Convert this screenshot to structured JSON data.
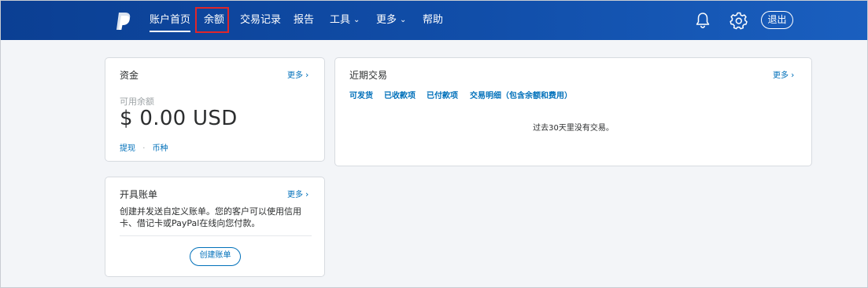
{
  "nav": {
    "items": [
      {
        "label": "账户首页",
        "active": true
      },
      {
        "label": "余额",
        "active": false
      },
      {
        "label": "交易记录",
        "active": false
      },
      {
        "label": "报告",
        "active": false
      },
      {
        "label": "工具",
        "active": false,
        "dropdown": true
      },
      {
        "label": "更多",
        "active": false,
        "dropdown": true
      },
      {
        "label": "帮助",
        "active": false
      }
    ],
    "logout_label": "退出",
    "icons": [
      "paypal-logo",
      "bell-icon",
      "gear-icon"
    ],
    "highlight_color": "#e0262a",
    "bar_color": "#114ea9"
  },
  "funds": {
    "title": "资金",
    "more_label": "更多",
    "available_label": "可用余额",
    "balance": "$ 0.00 USD",
    "withdraw_label": "提现",
    "separator": "·",
    "currency_label": "币种"
  },
  "invoice": {
    "title": "开具账单",
    "more_label": "更多",
    "description_line1": "创建并发送自定义账单。您的客户可以使用信用",
    "description_line2": "卡、借记卡或PayPal在线向您付款。",
    "create_button": "创建账单"
  },
  "recent": {
    "title": "近期交易",
    "more_label": "更多",
    "tabs": [
      {
        "label": "可发货"
      },
      {
        "label": "已收款项"
      },
      {
        "label": "已付款项"
      },
      {
        "label": "交易明细（包含余额和费用）"
      }
    ],
    "empty_message": "过去30天里没有交易。"
  },
  "accent_color": "#0070ba"
}
